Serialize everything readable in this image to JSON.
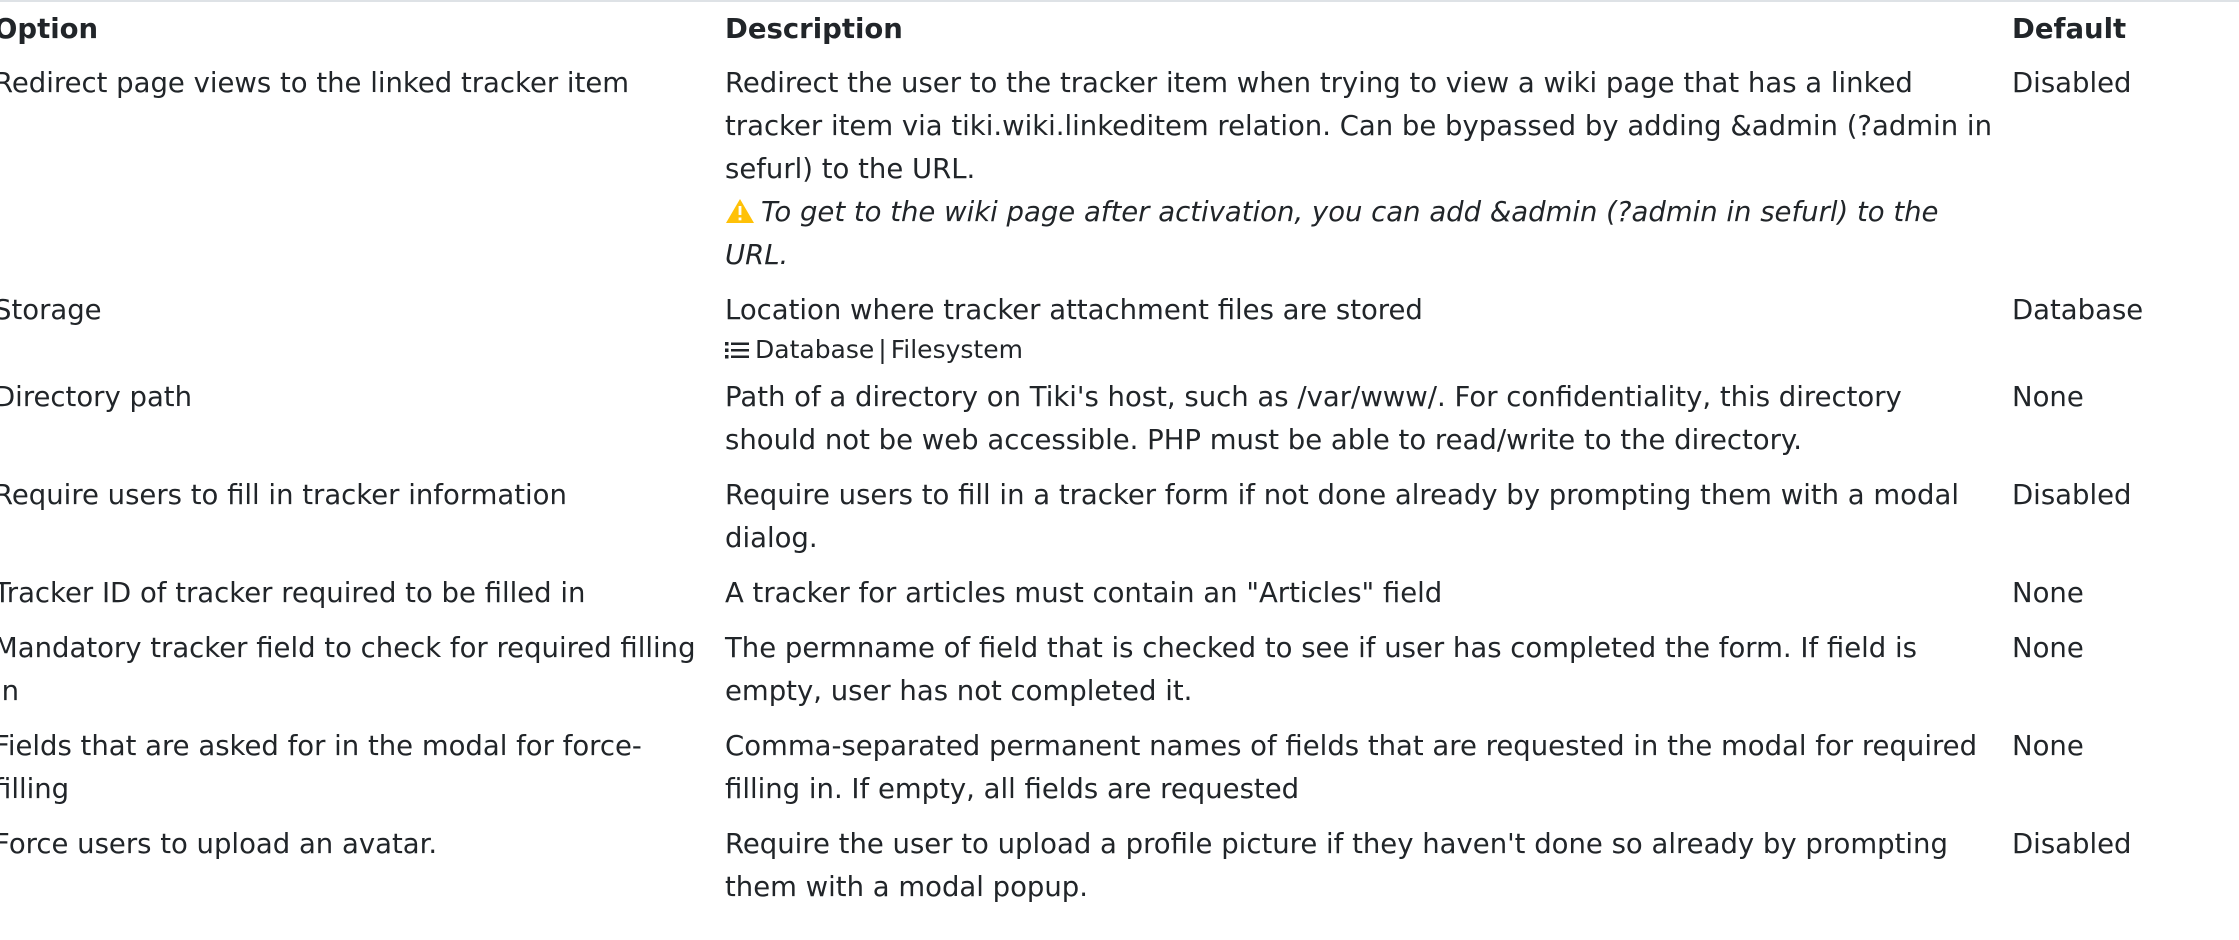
{
  "table": {
    "headers": {
      "option": "Option",
      "description": "Description",
      "default": "Default"
    },
    "rows": [
      {
        "option": "Redirect page views to the linked tracker item",
        "description": "Redirect the user to the tracker item when trying to view a wiki page that has a linked tracker item via tiki.wiki.linkeditem relation. Can be bypassed by adding &admin (?admin in sefurl) to the URL.",
        "warning": "To get to the wiki page after activation, you can add &admin (?admin in sefurl) to the URL.",
        "default": "Disabled"
      },
      {
        "option": "Storage",
        "description": "Location where tracker attachment files are stored",
        "choices": [
          "Database",
          "Filesystem"
        ],
        "choice_separator": "|",
        "default": "Database"
      },
      {
        "option": "Directory path",
        "description": "Path of a directory on Tiki's host, such as /var/www/. For confidentiality, this directory should not be web accessible. PHP must be able to read/write to the directory.",
        "default": "None"
      },
      {
        "option": "Require users to fill in tracker information",
        "description": "Require users to fill in a tracker form if not done already by prompting them with a modal dialog.",
        "default": "Disabled"
      },
      {
        "option": "Tracker ID of tracker required to be filled in",
        "description": "A tracker for articles must contain an \"Articles\" field",
        "default": "None"
      },
      {
        "option": "Mandatory tracker field to check for required filling in",
        "description": "The permname of field that is checked to see if user has completed the form. If field is empty, user has not completed it.",
        "default": "None"
      },
      {
        "option": "Fields that are asked for in the modal for force-filling",
        "description": "Comma-separated permanent names of fields that are requested in the modal for required filling in. If empty, all fields are requested",
        "default": "None"
      },
      {
        "option": "Force users to upload an avatar.",
        "description": "Require the user to upload a profile picture if they haven't done so already by prompting them with a modal popup.",
        "default": "Disabled"
      }
    ]
  },
  "icons": {
    "warning": "warning-triangle-icon",
    "list": "list-icon"
  },
  "colors": {
    "text": "#212529",
    "warning_icon": "#ffc107",
    "border": "#dee2e6"
  }
}
